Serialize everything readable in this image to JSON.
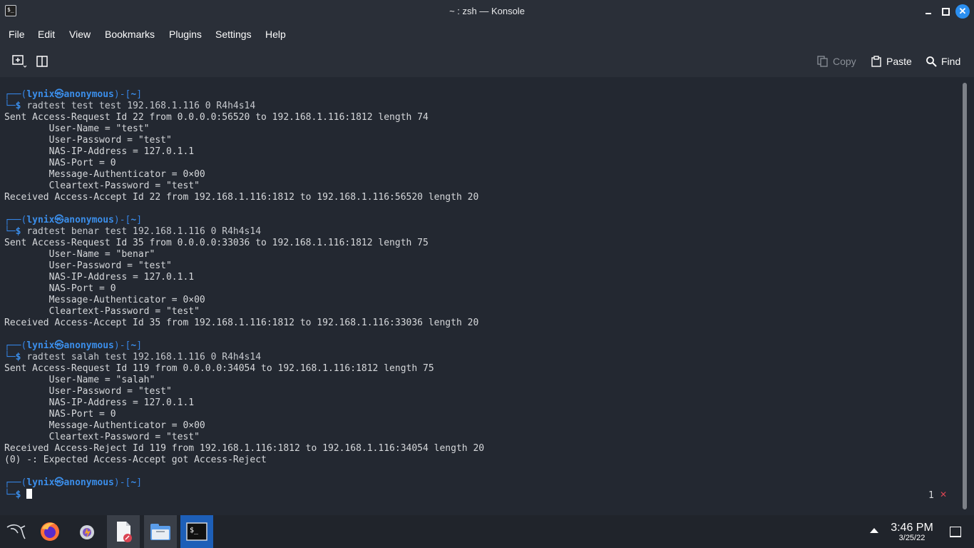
{
  "window": {
    "title": "~ : zsh — Konsole",
    "icon_name": "konsole-icon"
  },
  "menu": [
    "File",
    "Edit",
    "View",
    "Bookmarks",
    "Plugins",
    "Settings",
    "Help"
  ],
  "toolbar": {
    "copy_label": "Copy",
    "paste_label": "Paste",
    "find_label": "Find"
  },
  "prompt": {
    "user": "lynix",
    "host": "anonymous",
    "dir": "~"
  },
  "blocks": [
    {
      "command": "radtest test test 192.168.1.116 0 R4h4s14",
      "output": [
        "Sent Access-Request Id 22 from 0.0.0.0:56520 to 192.168.1.116:1812 length 74",
        "        User-Name = \"test\"",
        "        User-Password = \"test\"",
        "        NAS-IP-Address = 127.0.1.1",
        "        NAS-Port = 0",
        "        Message-Authenticator = 0×00",
        "        Cleartext-Password = \"test\"",
        "Received Access-Accept Id 22 from 192.168.1.116:1812 to 192.168.1.116:56520 length 20"
      ]
    },
    {
      "command": "radtest benar test 192.168.1.116 0 R4h4s14",
      "output": [
        "Sent Access-Request Id 35 from 0.0.0.0:33036 to 192.168.1.116:1812 length 75",
        "        User-Name = \"benar\"",
        "        User-Password = \"test\"",
        "        NAS-IP-Address = 127.0.1.1",
        "        NAS-Port = 0",
        "        Message-Authenticator = 0×00",
        "        Cleartext-Password = \"test\"",
        "Received Access-Accept Id 35 from 192.168.1.116:1812 to 192.168.1.116:33036 length 20"
      ]
    },
    {
      "command": "radtest salah test 192.168.1.116 0 R4h4s14",
      "output": [
        "Sent Access-Request Id 119 from 0.0.0.0:34054 to 192.168.1.116:1812 length 75",
        "        User-Name = \"salah\"",
        "        User-Password = \"test\"",
        "        NAS-IP-Address = 127.0.1.1",
        "        NAS-Port = 0",
        "        Message-Authenticator = 0×00",
        "        Cleartext-Password = \"test\"",
        "Received Access-Reject Id 119 from 192.168.1.116:1812 to 192.168.1.116:34054 length 20",
        "(0) -: Expected Access-Accept got Access-Reject"
      ]
    }
  ],
  "status": {
    "job_count": "1",
    "job_mark": "✕"
  },
  "taskbar": {
    "apps": [
      "kali-menu-icon",
      "firefox-icon",
      "burp-icon",
      "text-editor-icon",
      "file-manager-icon",
      "terminal-icon"
    ],
    "time": "3:46 PM",
    "date": "3/25/22"
  },
  "colors": {
    "background": "#232831",
    "prompt_frame": "#3584e4",
    "prompt_user": "#3b8eea",
    "close_button": "#2b8ff0"
  }
}
